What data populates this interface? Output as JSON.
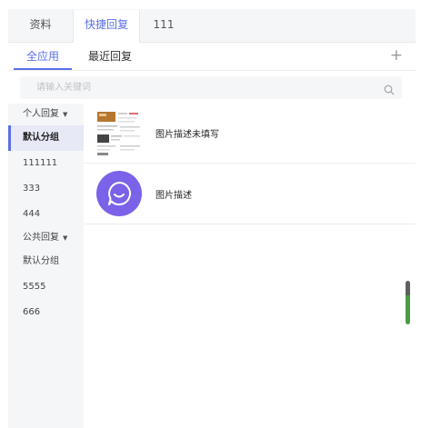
{
  "tabs": [
    {
      "label": "资料",
      "active": false
    },
    {
      "label": "快捷回复",
      "active": true
    },
    {
      "label": "111",
      "active": false
    }
  ],
  "subtabs": [
    {
      "label": "全应用",
      "active": true
    },
    {
      "label": "最近回复",
      "active": false
    }
  ],
  "add_icon": "plus-icon",
  "search": {
    "placeholder": "请输入关键词",
    "value": "",
    "icon": "search-icon"
  },
  "sidebar": {
    "personal_group_label": "个人回复",
    "personal_items": [
      {
        "label": "默认分组",
        "active": true
      },
      {
        "label": "111111",
        "active": false
      },
      {
        "label": "333",
        "active": false
      },
      {
        "label": "444",
        "active": false
      }
    ],
    "public_group_label": "公共回复",
    "public_items": [
      {
        "label": "默认分组",
        "active": false
      },
      {
        "label": "5555",
        "active": false
      },
      {
        "label": "666",
        "active": false
      }
    ]
  },
  "replies": [
    {
      "title": "图片描述未填写",
      "thumb": "document-screenshot-thumbnail"
    },
    {
      "title": "图片描述",
      "thumb": "smile-chat-icon"
    }
  ],
  "colors": {
    "accent": "#5b6fe6",
    "avatar": "#7b62e8",
    "sidebar_bg": "#f5f6f8",
    "active_item_bg": "#e7e9f7"
  }
}
